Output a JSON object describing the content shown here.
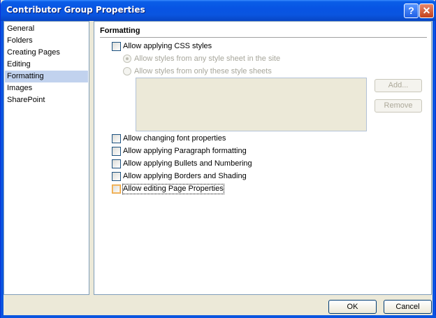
{
  "window": {
    "title": "Contributor Group Properties",
    "help_glyph": "?",
    "close_glyph": "✕"
  },
  "nav": {
    "items": [
      {
        "label": "General"
      },
      {
        "label": "Folders"
      },
      {
        "label": "Creating Pages"
      },
      {
        "label": "Editing"
      },
      {
        "label": "Formatting",
        "selected": true
      },
      {
        "label": "Images"
      },
      {
        "label": "SharePoint"
      }
    ]
  },
  "panel": {
    "title": "Formatting",
    "css_styles": {
      "label": "Allow applying CSS styles",
      "checked": false
    },
    "style_source": {
      "any": {
        "label": "Allow styles from any style sheet in the site",
        "checked": true,
        "enabled": false
      },
      "only": {
        "label": "Allow styles from only these style sheets",
        "checked": false,
        "enabled": false
      }
    },
    "add_button": "Add...",
    "remove_button": "Remove",
    "font_properties": {
      "label": "Allow changing font properties",
      "checked": false
    },
    "paragraph_formatting": {
      "label": "Allow applying Paragraph formatting",
      "checked": false
    },
    "bullets_numbering": {
      "label": "Allow applying Bullets and Numbering",
      "checked": false
    },
    "borders_shading": {
      "label": "Allow applying Borders and Shading",
      "checked": false
    },
    "page_properties": {
      "label": "Allow editing Page Properties",
      "checked": false
    }
  },
  "footer": {
    "ok_label": "OK",
    "cancel_label": "Cancel"
  }
}
